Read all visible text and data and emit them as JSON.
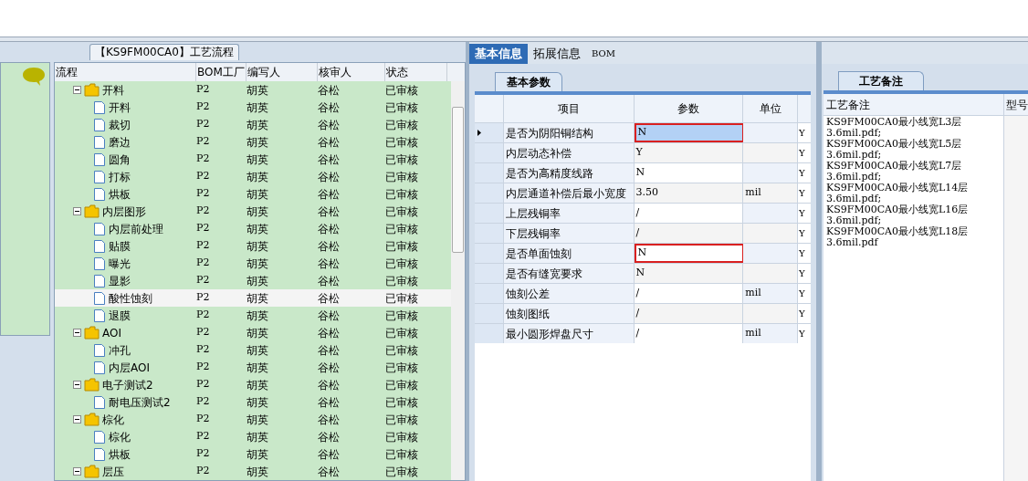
{
  "process_panel": {
    "title": "【KS9FM00CA0】工艺流程",
    "columns": [
      "流程",
      "BOM工厂",
      "编写人",
      "核审人",
      "状态"
    ],
    "tree": [
      {
        "name": "开料",
        "factory": "P2",
        "author": "胡英",
        "reviewer": "谷松",
        "status": "已审核",
        "selected": false,
        "expanded": true,
        "children": [
          {
            "name": "开料",
            "factory": "P2",
            "author": "胡英",
            "reviewer": "谷松",
            "status": "已审核",
            "selected": false
          },
          {
            "name": "裁切",
            "factory": "P2",
            "author": "胡英",
            "reviewer": "谷松",
            "status": "已审核",
            "selected": false
          },
          {
            "name": "磨边",
            "factory": "P2",
            "author": "胡英",
            "reviewer": "谷松",
            "status": "已审核",
            "selected": false
          },
          {
            "name": "圆角",
            "factory": "P2",
            "author": "胡英",
            "reviewer": "谷松",
            "status": "已审核",
            "selected": false
          },
          {
            "name": "打标",
            "factory": "P2",
            "author": "胡英",
            "reviewer": "谷松",
            "status": "已审核",
            "selected": false
          },
          {
            "name": "烘板",
            "factory": "P2",
            "author": "胡英",
            "reviewer": "谷松",
            "status": "已审核",
            "selected": false
          }
        ]
      },
      {
        "name": "内层图形",
        "factory": "P2",
        "author": "胡英",
        "reviewer": "谷松",
        "status": "已审核",
        "selected": false,
        "expanded": true,
        "children": [
          {
            "name": "内层前处理",
            "factory": "P2",
            "author": "胡英",
            "reviewer": "谷松",
            "status": "已审核",
            "selected": false
          },
          {
            "name": "贴膜",
            "factory": "P2",
            "author": "胡英",
            "reviewer": "谷松",
            "status": "已审核",
            "selected": false
          },
          {
            "name": "曝光",
            "factory": "P2",
            "author": "胡英",
            "reviewer": "谷松",
            "status": "已审核",
            "selected": false
          },
          {
            "name": "显影",
            "factory": "P2",
            "author": "胡英",
            "reviewer": "谷松",
            "status": "已审核",
            "selected": false
          },
          {
            "name": "酸性蚀刻",
            "factory": "P2",
            "author": "胡英",
            "reviewer": "谷松",
            "status": "已审核",
            "selected": true
          },
          {
            "name": "退膜",
            "factory": "P2",
            "author": "胡英",
            "reviewer": "谷松",
            "status": "已审核",
            "selected": false
          }
        ]
      },
      {
        "name": "AOI",
        "factory": "P2",
        "author": "胡英",
        "reviewer": "谷松",
        "status": "已审核",
        "selected": false,
        "expanded": true,
        "children": [
          {
            "name": "冲孔",
            "factory": "P2",
            "author": "胡英",
            "reviewer": "谷松",
            "status": "已审核",
            "selected": false
          },
          {
            "name": "内层AOI",
            "factory": "P2",
            "author": "胡英",
            "reviewer": "谷松",
            "status": "已审核",
            "selected": false
          }
        ]
      },
      {
        "name": "电子测试2",
        "factory": "P2",
        "author": "胡英",
        "reviewer": "谷松",
        "status": "已审核",
        "selected": false,
        "expanded": true,
        "children": [
          {
            "name": "耐电压测试2",
            "factory": "P2",
            "author": "胡英",
            "reviewer": "谷松",
            "status": "已审核",
            "selected": false
          }
        ]
      },
      {
        "name": "棕化",
        "factory": "P2",
        "author": "胡英",
        "reviewer": "谷松",
        "status": "已审核",
        "selected": false,
        "expanded": true,
        "children": [
          {
            "name": "棕化",
            "factory": "P2",
            "author": "胡英",
            "reviewer": "谷松",
            "status": "已审核",
            "selected": false
          },
          {
            "name": "烘板",
            "factory": "P2",
            "author": "胡英",
            "reviewer": "谷松",
            "status": "已审核",
            "selected": false
          }
        ]
      },
      {
        "name": "层压",
        "factory": "P2",
        "author": "胡英",
        "reviewer": "谷松",
        "status": "已审核",
        "selected": false,
        "expanded": true
      }
    ]
  },
  "info_panel": {
    "tabs": [
      {
        "label": "基本信息",
        "selected": true
      },
      {
        "label": "拓展信息",
        "selected": false
      },
      {
        "label": "BOM",
        "selected": false
      }
    ],
    "subtab": "基本参数",
    "columns": [
      "项目",
      "参数",
      "单位"
    ],
    "rows": [
      {
        "item": "是否为阴阳铜结构",
        "value": "N",
        "unit": "",
        "column_4": "Y",
        "current": true,
        "highlighted": true
      },
      {
        "item": "内层动态补偿",
        "value": "Y",
        "unit": "",
        "column_4": "Y",
        "current": false,
        "highlighted": false
      },
      {
        "item": "是否为高精度线路",
        "value": "N",
        "unit": "",
        "column_4": "Y",
        "current": false,
        "highlighted": false
      },
      {
        "item": "内层通道补偿后最小宽度",
        "value": "3.50",
        "unit": "mil",
        "column_4": "Y",
        "current": false,
        "highlighted": false
      },
      {
        "item": "上层残铜率",
        "value": "/",
        "unit": "",
        "column_4": "Y",
        "current": false,
        "highlighted": false
      },
      {
        "item": "下层残铜率",
        "value": "/",
        "unit": "",
        "column_4": "Y",
        "current": false,
        "highlighted": false
      },
      {
        "item": "是否单面蚀刻",
        "value": "N",
        "unit": "",
        "column_4": "Y",
        "current": false,
        "highlighted": true
      },
      {
        "item": "是否有缝宽要求",
        "value": "N",
        "unit": "",
        "column_4": "Y",
        "current": false,
        "highlighted": false
      },
      {
        "item": "蚀刻公差",
        "value": "/",
        "unit": "mil",
        "column_4": "Y",
        "current": false,
        "highlighted": false
      },
      {
        "item": "蚀刻图纸",
        "value": "/",
        "unit": "",
        "column_4": "Y",
        "current": false,
        "highlighted": false
      },
      {
        "item": "最小圆形焊盘尺寸",
        "value": "/",
        "unit": "mil",
        "column_4": "Y",
        "current": false,
        "highlighted": false
      }
    ]
  },
  "notes_panel": {
    "tab": "工艺备注",
    "columns": [
      "工艺备注",
      "型号"
    ],
    "note_lines": [
      "KS9FM00CA0最小线宽L3层",
      "3.6mil.pdf;",
      "KS9FM00CA0最小线宽L5层",
      "3.6mil.pdf;",
      "KS9FM00CA0最小线宽L7层",
      "3.6mil.pdf;",
      "KS9FM00CA0最小线宽L14层",
      "3.6mil.pdf;",
      "KS9FM00CA0最小线宽L16层",
      "3.6mil.pdf;",
      "KS9FM00CA0最小线宽L18层",
      "3.6mil.pdf"
    ]
  }
}
